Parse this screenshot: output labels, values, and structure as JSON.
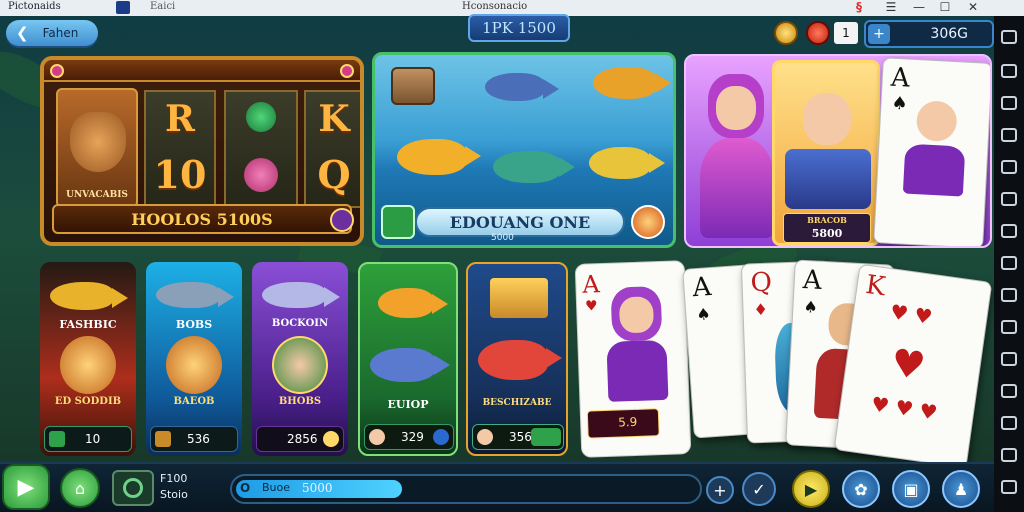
{
  "window": {
    "app_title": "Pictonaids",
    "tab_label": "Eaici",
    "center_title": "Hconsonacio"
  },
  "hud": {
    "back_label": "Fahen",
    "banner": "1PK 1500",
    "small_count": "1",
    "balance": "306G"
  },
  "featured": {
    "slot": {
      "symbols": [
        "R",
        "K",
        "10",
        "Q"
      ],
      "badge": "UNVACABIS",
      "jackpot": "HOOLOS 5100S"
    },
    "fish": {
      "title": "EDOUANG ONE",
      "sub": "5000"
    },
    "cards": {
      "title": "BRACOB",
      "value": "5800",
      "rank": "A"
    }
  },
  "games": [
    {
      "title": "FASHBIC",
      "subtitle": "ED SODDIB",
      "value": "10",
      "accent": "#d2322a"
    },
    {
      "title": "BOBS",
      "subtitle": "BAEOB",
      "value": "536",
      "accent": "#1d88c9"
    },
    {
      "title": "BOCKOIN",
      "subtitle": "BHOBS",
      "value": "2856",
      "accent": "#6a3fb5"
    },
    {
      "title": "",
      "subtitle": "EUIOP",
      "value": "329",
      "accent": "#2e9b3a"
    },
    {
      "title": "",
      "subtitle": "BESCHIZABE",
      "value": "356",
      "accent": "#c34b1c"
    },
    {
      "title": "",
      "subtitle": "5.9",
      "value": "",
      "accent": "#e8a32c"
    }
  ],
  "card_fan": [
    "A",
    "Q",
    "A",
    "K"
  ],
  "bottom": {
    "item_title": "F100",
    "item_sub": "Stoio",
    "progress_prefix": "O",
    "progress_label": "Buoe",
    "progress_value": "5000",
    "progress_fraction": 0.36
  },
  "colors": {
    "accent_blue": "#3b86c8",
    "accent_green": "#48c06a",
    "accent_gold": "#d79b3a"
  }
}
